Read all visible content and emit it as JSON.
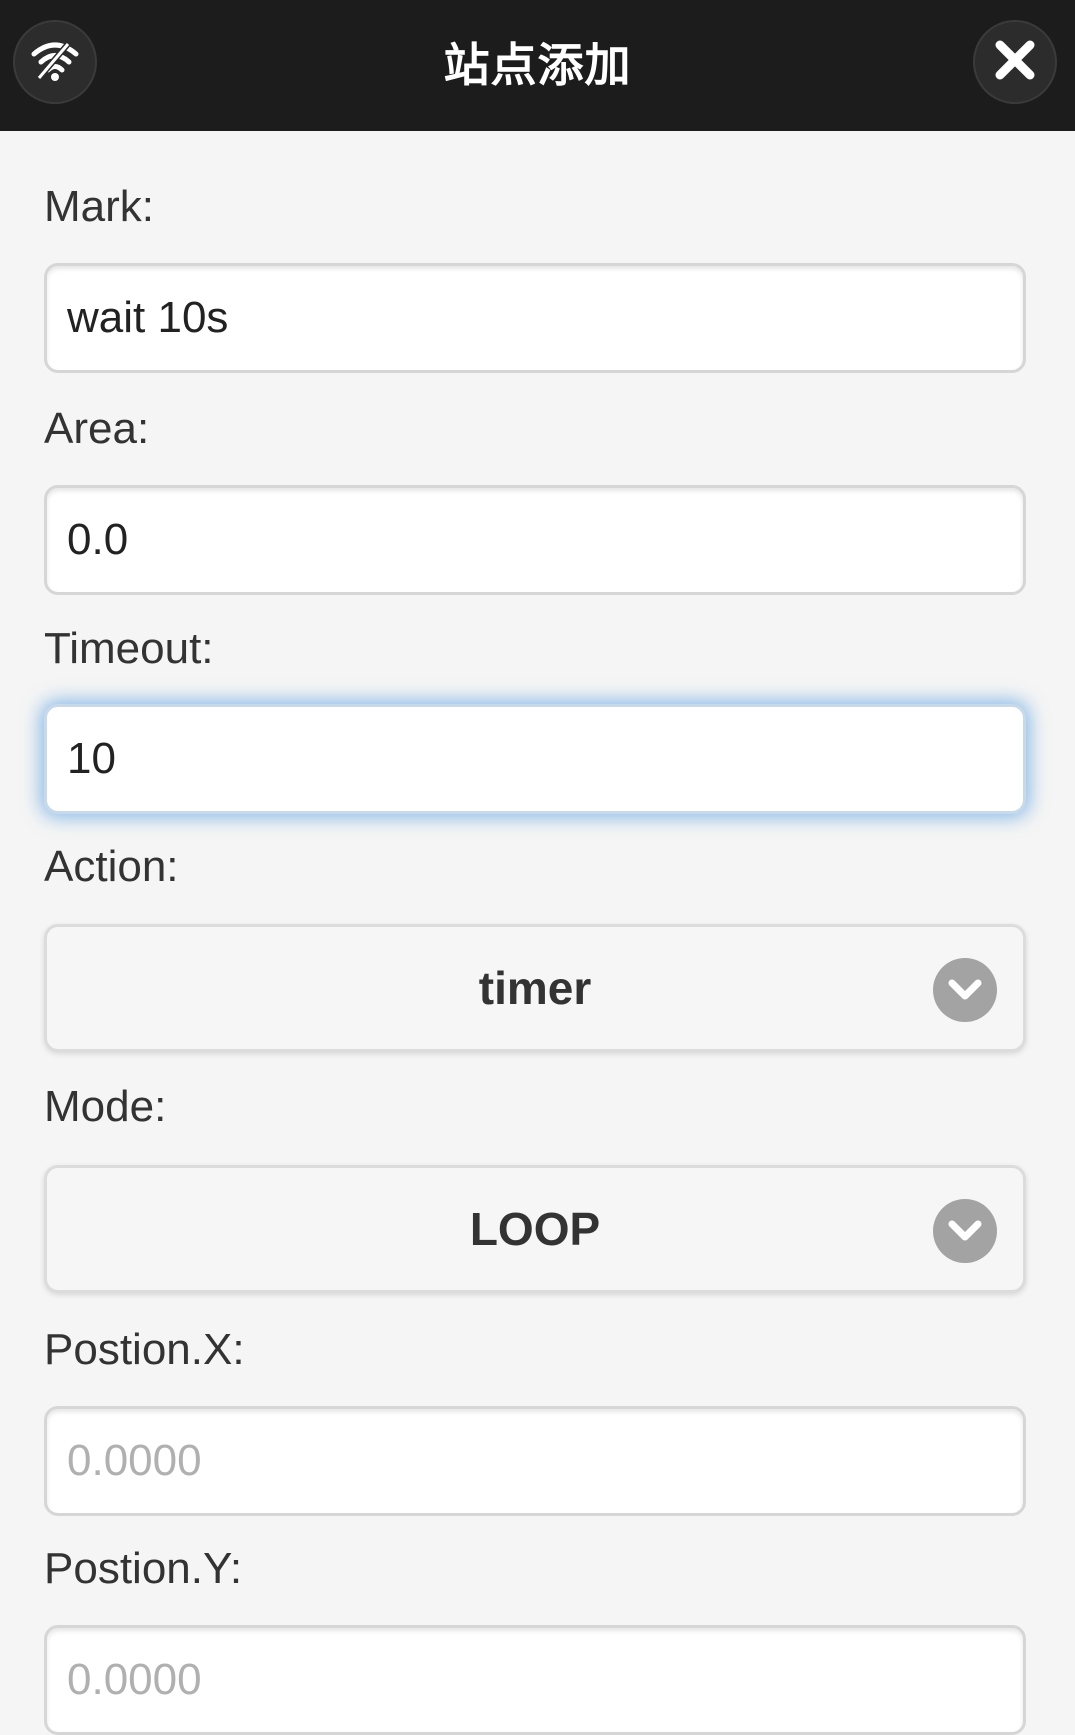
{
  "header": {
    "title": "站点添加",
    "left_icon": "wifi-icon",
    "right_icon": "close-icon"
  },
  "form": {
    "mark": {
      "label": "Mark:",
      "value": "wait 10s"
    },
    "area": {
      "label": "Area:",
      "value": "0.0"
    },
    "timeout": {
      "label": "Timeout:",
      "value": "10"
    },
    "action": {
      "label": "Action:",
      "selected": "timer",
      "icon": "chevron-down-icon"
    },
    "mode": {
      "label": "Mode:",
      "selected": "LOOP",
      "icon": "chevron-down-icon"
    },
    "position_x": {
      "label": "Postion.X:",
      "placeholder": "0.0000"
    },
    "position_y": {
      "label": "Postion.Y:",
      "placeholder": "0.0000"
    }
  },
  "colors": {
    "header_bg": "#1c1c1c",
    "page_bg": "#f5f5f5",
    "focus_glow": "#388cde",
    "select_icon_bg": "#a3a3a3"
  }
}
